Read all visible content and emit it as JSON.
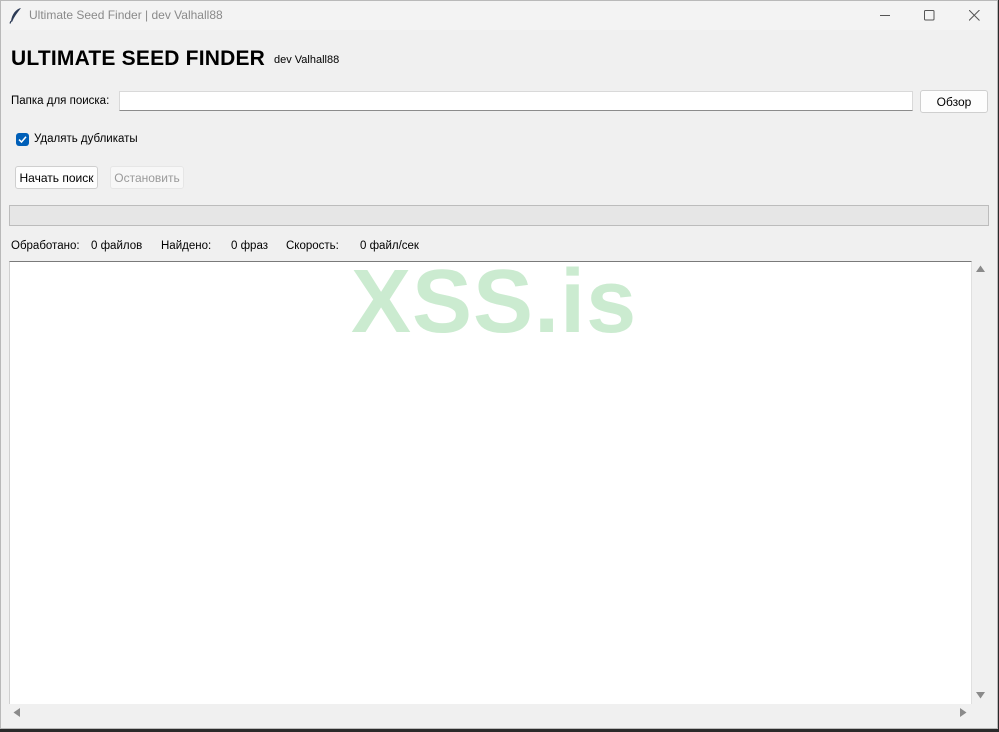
{
  "window": {
    "title": "Ultimate Seed Finder | dev Valhall88",
    "icon": "feather-icon"
  },
  "header": {
    "title": "ULTIMATE SEED FINDER",
    "subtitle": "dev Valhall88"
  },
  "folder": {
    "label": "Папка для поиска:",
    "value": "",
    "browse_label": "Обзор"
  },
  "options": {
    "remove_duplicates_label": "Удалять дубликаты",
    "remove_duplicates_checked": true
  },
  "actions": {
    "start_label": "Начать поиск",
    "stop_label": "Остановить",
    "stop_enabled": false
  },
  "progress": {
    "value": 0
  },
  "stats": {
    "processed_label": "Обработано:",
    "processed_value": "0 файлов",
    "found_label": "Найдено:",
    "found_value": "0 фраз",
    "speed_label": "Скорость:",
    "speed_value": "0 файл/сек"
  },
  "watermark": "XSS.is",
  "colors": {
    "accent": "#005fb8",
    "watermark": "#c3e8c8"
  }
}
